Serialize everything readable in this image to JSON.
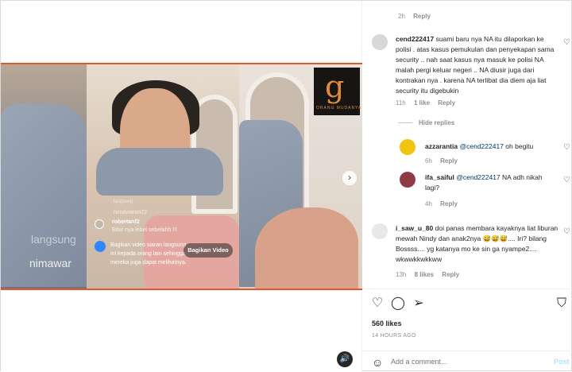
{
  "video": {
    "watermark_top": "langsung",
    "watermark_bottom": "nimawar",
    "small_handle": "nimawaron22",
    "small_label": "langsung",
    "live_comment": {
      "user": "robertanf2",
      "message": "Bibir nya lebel sebelahh !!!"
    },
    "share_info": "Bagikan video siaran langsung ini kepada orang lain sehingga mereka juga dapat melihatnya.",
    "share_button": "Bagikan Video",
    "brand_logo_text": "ORANG MUDANYA",
    "next_icon": "chevron-right-icon",
    "audio_icon": "speaker-icon"
  },
  "top_comment_meta": {
    "time": "2h",
    "reply": "Reply"
  },
  "comments": [
    {
      "user": "cend222417",
      "text": "suami baru nya NA itu dilaporkan ke polisi . atas kasus pemukulan dan penyekapan sama security .. nah saat kasus nya masuk ke polisi NA malah pergi keluar negeri .. NA diusir juga dari kontrakan nya . karena NA terlibat dia diem aja liat security itu digebukin",
      "time": "11h",
      "likes": "1 like",
      "reply": "Reply",
      "avatar_color": "#d8d8d8"
    },
    {
      "user": "azzarantia",
      "mention": "@cend222417",
      "text": "oh begitu",
      "time": "6h",
      "reply": "Reply",
      "avatar_color": "#f1c40f"
    },
    {
      "user": "ifa_saiful",
      "mention": "@cend222417",
      "text": "NA adh nikah lagi?",
      "time": "4h",
      "reply": "Reply",
      "avatar_color": "#8e3b46"
    },
    {
      "user": "i_saw_u_80",
      "text": "doi panas membara kayaknya liat liburan mewah Nindy dan anak2nya 😅😅😅.... Iri? bilang Bossss.... yg katanya mo ke sin ga nyampe2.... wkwwkkwkkww",
      "time": "13h",
      "likes": "8 likes",
      "reply": "Reply",
      "avatar_color": "#e8e8e8"
    }
  ],
  "hide_replies": "Hide replies",
  "actions": {
    "like_icon": "heart-icon",
    "comment_icon": "comment-icon",
    "share_icon": "send-icon",
    "save_icon": "bookmark-icon"
  },
  "likes": "560 likes",
  "posted": "14 HOURS AGO",
  "add_comment": {
    "placeholder": "Add a comment...",
    "post": "Post",
    "emoji_icon": "smiley-icon"
  }
}
